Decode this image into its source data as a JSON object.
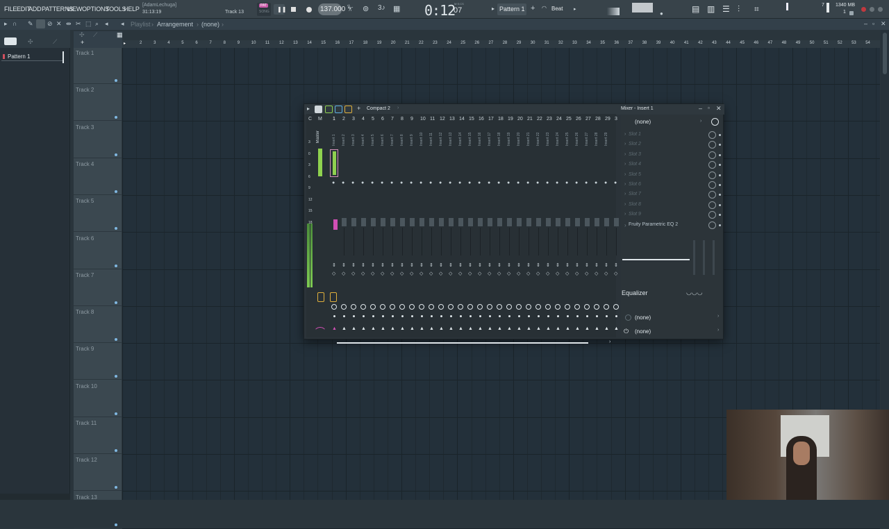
{
  "menu": [
    "FILE",
    "EDIT",
    "ADD",
    "PATTERNS",
    "VIEW",
    "OPTIONS",
    "TOOLS",
    "HELP"
  ],
  "project": {
    "user": "[AdamLechuga]",
    "time": "31:13:19",
    "track": "Track 13"
  },
  "transport": {
    "pat_label": "PAT",
    "song_label": "SONG",
    "tempo": "137.000",
    "time_display": "0:12",
    "time_frames": "07",
    "msc": "M:S:CS",
    "pattern": "Pattern 1",
    "beat": "Beat"
  },
  "cpu": {
    "memory": "1340 MB",
    "voices": "7",
    "value2": "1"
  },
  "playlist": {
    "breadcrumb": "Playlist",
    "arrangement": "Arrangement",
    "sel": "(none)"
  },
  "pattern_list": [
    {
      "label": "Pattern 1"
    }
  ],
  "tracks": [
    "Track 1",
    "Track 2",
    "Track 3",
    "Track 4",
    "Track 5",
    "Track 6",
    "Track 7",
    "Track 8",
    "Track 9",
    "Track 10",
    "Track 11",
    "Track 12",
    "Track 13"
  ],
  "ruler": [
    "2",
    "3",
    "4",
    "5",
    "6",
    "7",
    "8",
    "9",
    "10",
    "11",
    "12",
    "13",
    "14",
    "15",
    "16",
    "17",
    "18",
    "19",
    "20",
    "21",
    "22",
    "23",
    "24",
    "25",
    "26",
    "27",
    "28",
    "29",
    "30",
    "31",
    "32",
    "33",
    "34",
    "35",
    "36",
    "37",
    "38",
    "39",
    "40",
    "41",
    "42",
    "43",
    "44",
    "45",
    "46",
    "47",
    "48",
    "49",
    "50",
    "51",
    "52",
    "53",
    "54"
  ],
  "mixer": {
    "layout_name": "Compact 2",
    "cm_labels": [
      "C",
      "M"
    ],
    "master_label": "Master",
    "inserts": [
      "1",
      "2",
      "3",
      "4",
      "5",
      "6",
      "7",
      "8",
      "9",
      "10",
      "11",
      "12",
      "13",
      "14",
      "15",
      "16",
      "17",
      "18",
      "19",
      "20",
      "21",
      "22",
      "23",
      "24",
      "25",
      "26",
      "27",
      "28",
      "29",
      "3"
    ],
    "insert_names": [
      "Insert 1",
      "Insert 2",
      "Insert 3",
      "Insert 4",
      "Insert 5",
      "Insert 6",
      "Insert 7",
      "Insert 8",
      "Insert 9",
      "Insert 10",
      "Insert 11",
      "Insert 12",
      "Insert 13",
      "Insert 14",
      "Insert 15",
      "Insert 16",
      "Insert 17",
      "Insert 18",
      "Insert 19",
      "Insert 20",
      "Insert 21",
      "Insert 22",
      "Insert 23",
      "Insert 24",
      "Insert 25",
      "Insert 26",
      "Insert 27",
      "Insert 28",
      "Insert 29"
    ],
    "db_scale": [
      "3",
      "0",
      "3",
      "6",
      "9",
      "12",
      "15",
      "18"
    ],
    "title": "Mixer - Insert 1",
    "input": "(none)",
    "slots": [
      "Slot 1",
      "Slot 2",
      "Slot 3",
      "Slot 4",
      "Slot 5",
      "Slot 6",
      "Slot 7",
      "Slot 8",
      "Slot 9"
    ],
    "plugin": "Fruity Parametric EQ 2",
    "eq_label": "Equalizer",
    "out1": "(none)",
    "out2": "(none)",
    "accent_green": "#8fd14f",
    "accent_pink": "#d14fb5"
  }
}
